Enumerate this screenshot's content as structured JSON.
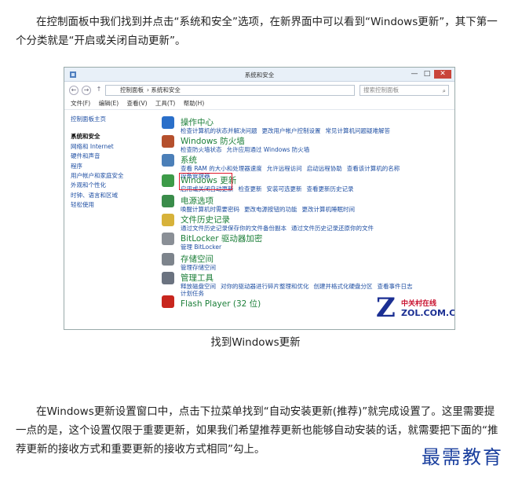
{
  "article": {
    "para1": "在控制面板中我们找到并点击“系统和安全”选项，在新界面中可以看到“Windows更新”，其下第一个分类就是“开启或关闭自动更新”。",
    "caption": "找到Windows更新",
    "para2": "在Windows更新设置窗口中，点击下拉菜单找到“自动安装更新(推荐)”就完成设置了。这里需要提一点的是，这个设置仅限于重要更新，如果我们希望推荐更新也能够自动安装的话，就需要把下面的“推荐更新的接收方式和重要更新的接收方式相同”勾上。",
    "watermark": "最需教育"
  },
  "window": {
    "title": "系统和安全",
    "back": "←",
    "forward": "→",
    "up": "↑",
    "minimize": "—",
    "maximize": "□",
    "close": "✕",
    "breadcrumb": [
      "控制面板",
      "系统和安全"
    ],
    "search_placeholder": "搜索控制面板",
    "search_icon": "⌕",
    "menu": [
      "文件(F)",
      "编辑(E)",
      "查看(V)",
      "工具(T)",
      "帮助(H)"
    ]
  },
  "sidebar": {
    "home": "控制面板主页",
    "items": [
      "系统和安全",
      "网络和 Internet",
      "硬件和声音",
      "程序",
      "用户帐户和家庭安全",
      "外观和个性化",
      "时钟、语言和区域",
      "轻松使用"
    ]
  },
  "categories": [
    {
      "title": "操作中心",
      "links": [
        "检查计算机的状态并解决问题",
        "更改用户帐户控制设置",
        "常见计算机问题疑难解答"
      ],
      "icon": "flag-icon",
      "color": "#2a6fc9"
    },
    {
      "title": "Windows 防火墙",
      "links": [
        "检查防火墙状态",
        "允许应用通过 Windows 防火墙"
      ],
      "icon": "firewall-icon",
      "color": "#b5502d"
    },
    {
      "title": "系统",
      "links": [
        "查看 RAM 的大小和处理器速度",
        "允许远程访问",
        "启动远程协助",
        "查看该计算机的名称"
      ],
      "links2": [
        "设备管理器"
      ],
      "icon": "computer-icon",
      "color": "#4b7fb8"
    },
    {
      "title": "Windows 更新",
      "links": [
        "启用或关闭自动更新",
        "检查更新",
        "安装可选更新",
        "查看更新历史记录"
      ],
      "icon": "update-icon",
      "color": "#3d9b48"
    },
    {
      "title": "电源选项",
      "links": [
        "唤醒计算机时需要密码",
        "更改电源按钮的功能",
        "更改计算机睡眠时间"
      ],
      "icon": "power-icon",
      "color": "#3a8c4a"
    },
    {
      "title": "文件历史记录",
      "links": [
        "通过文件历史记录保存你的文件备份副本",
        "通过文件历史记录还原你的文件"
      ],
      "icon": "folder-icon",
      "color": "#d7b23a"
    },
    {
      "title": "BitLocker 驱动器加密",
      "links": [
        "管理 BitLocker"
      ],
      "icon": "bitlocker-icon",
      "color": "#8a8f96"
    },
    {
      "title": "存储空间",
      "links": [
        "管理存储空间"
      ],
      "icon": "storage-icon",
      "color": "#7d848c"
    },
    {
      "title": "管理工具",
      "links": [
        "释放磁盘空间",
        "对你的驱动器进行碎片整理和优化",
        "创建并格式化硬盘分区",
        "查看事件日志"
      ],
      "links2": [
        "计划任务"
      ],
      "icon": "tools-icon",
      "color": "#6b7380"
    },
    {
      "title": "Flash Player (32 位)",
      "links": [],
      "icon": "flash-icon",
      "color": "#c8261e"
    }
  ],
  "logo": {
    "mark": "Z",
    "line1": "中关村在线",
    "line2": "ZOL.COM.CN"
  }
}
